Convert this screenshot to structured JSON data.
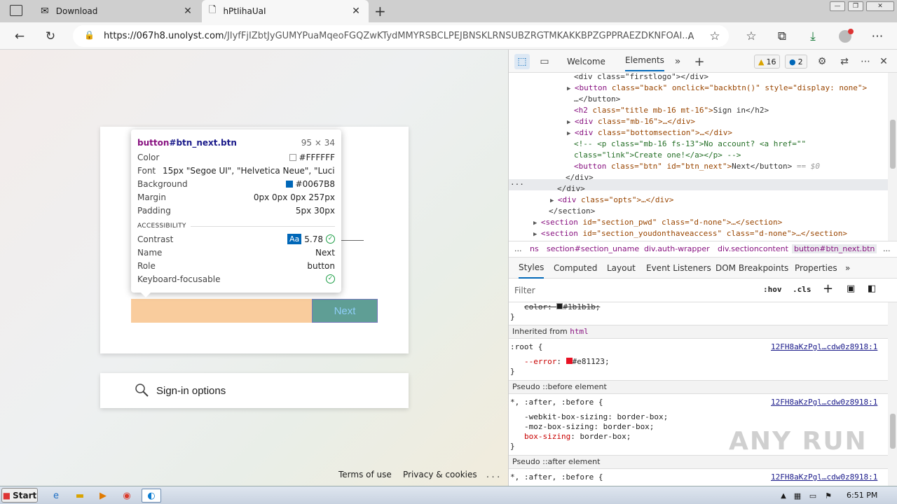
{
  "browser": {
    "tabs": [
      {
        "title": "Download"
      },
      {
        "title": "hPtIihaUaI"
      }
    ],
    "url_host": "https://067h8.unolyst.com",
    "url_path": "/JIyfFjIZbtJyGUMYPuaMqeoFGQZwKTydMMYRSBCLPEJBNSKLRNSUBZRGTMKAKKBPZGPPRAEZDKNFOAI..."
  },
  "page": {
    "next_label": "Next",
    "signin_options": "Sign-in options",
    "footer": {
      "terms": "Terms of use",
      "privacy": "Privacy & cookies",
      "more": ". . ."
    }
  },
  "tooltip": {
    "selector_tag": "button",
    "selector_id": "#btn_next.btn",
    "size": "95 × 34",
    "color_label": "Color",
    "color_value": "#FFFFFF",
    "font_label": "Font",
    "font_value": "15px \"Segoe UI\", \"Helvetica Neue\", \"Luci...",
    "background_label": "Background",
    "background_value": "#0067B8",
    "margin_label": "Margin",
    "margin_value": "0px 0px 0px 257px",
    "padding_label": "Padding",
    "padding_value": "5px 30px",
    "accessibility_label": "ACCESSIBILITY",
    "contrast_label": "Contrast",
    "contrast_aa": "Aa",
    "contrast_value": "5.78",
    "name_label": "Name",
    "name_value": "Next",
    "role_label": "Role",
    "role_value": "button",
    "keyboard_label": "Keyboard-focusable"
  },
  "devtools": {
    "tabs": {
      "welcome": "Welcome",
      "elements": "Elements"
    },
    "warnings": "16",
    "issues": "2",
    "dom_lines": [
      {
        "indent": 0,
        "text": "<div class=\"firstlogo\"></div>"
      },
      {
        "indent": 0,
        "tri": true,
        "tag": "<button",
        "attrs": " class=\"back\" onclick=\"backbtn()\" style=\"display: none\">"
      },
      {
        "indent": 0,
        "text": "…</button>"
      },
      {
        "indent": 0,
        "tag": "<h2",
        "attrs": " class=\"title mb-16 mt-16\">",
        "text": "Sign in</h2>"
      },
      {
        "indent": 0,
        "tri": true,
        "tag": "<div",
        "attrs": " class=\"mb-16\">…</div>"
      },
      {
        "indent": 0,
        "tri": true,
        "tag": "<div",
        "attrs": " class=\"bottomsection\">…</div>"
      },
      {
        "indent": 0,
        "comment": "<!-- <p class=\"mb-16 fs-13\">No account? <a href=\"\""
      },
      {
        "indent": 0,
        "comment": "class=\"link\">Create one!</a></p> -->"
      },
      {
        "indent": 0,
        "tag": "<button",
        "attrs": " class=\"btn\" id=\"btn_next\">",
        "text": "Next</button>",
        "suffix": " == $0"
      },
      {
        "indent": -1,
        "text": "</div>"
      },
      {
        "indent": -2,
        "text": "</div>"
      },
      {
        "indent": -2,
        "tri": true,
        "tag": "<div",
        "attrs": " class=\"opts\">…</div>"
      },
      {
        "indent": -3,
        "text": "</section>"
      },
      {
        "indent": -4,
        "tri": true,
        "tag": "<section",
        "attrs": " id=\"section_pwd\" class=\"d-none\">…</section>"
      },
      {
        "indent": -4,
        "tri": true,
        "tag": "<section",
        "attrs": " id=\"section_youdonthaveaccess\" class=\"d-none\">…</section>"
      }
    ],
    "breadcrumbs": [
      "...",
      "ns",
      "section#section_uname",
      "div.auth-wrapper",
      "div.sectioncontent",
      "button#btn_next.btn",
      "..."
    ],
    "subtabs": [
      "Styles",
      "Computed",
      "Layout",
      "Event Listeners",
      "DOM Breakpoints",
      "Properties"
    ],
    "filter_placeholder": "Filter",
    "hov": ":hov",
    "cls": ".cls",
    "styles": {
      "top_prop": "color: ",
      "top_value": "#1b1b1b;",
      "top_color": "#1b1b1b",
      "inherited_label": "Inherited from ",
      "inherited_from": "html",
      "root_selector": ":root {",
      "root_source": "12FH8aKzPgl…cdw0z8918:1",
      "error_prop": "--error",
      "error_value": "#e81123;",
      "error_color": "#e81123",
      "pseudo_before": "Pseudo ::before element",
      "pseudo_after": "Pseudo ::after element",
      "universal_selector": "*, :after, :before {",
      "webkit": "-webkit-box-sizing: border-box;",
      "moz": "-moz-box-sizing: border-box;",
      "box_prop": "box-sizing",
      "box_value": "border-box;",
      "close": "}"
    }
  },
  "taskbar": {
    "start": "Start",
    "clock": "6:51 PM"
  },
  "watermark": "ANY RUN"
}
